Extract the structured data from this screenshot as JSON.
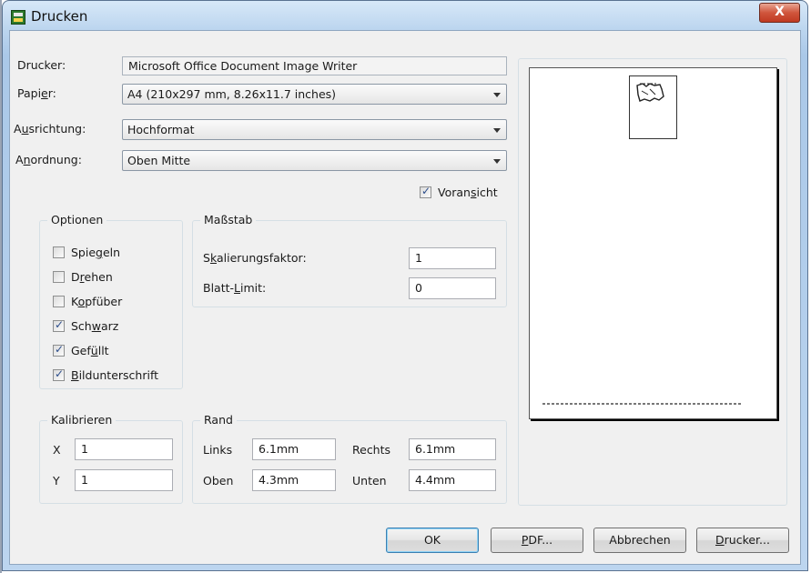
{
  "window": {
    "title": "Drucken",
    "close_glyph": "X"
  },
  "fields": {
    "drucker": {
      "label_pre": "Drucker:",
      "value": "Microsoft Office Document Image Writer"
    },
    "papier": {
      "label_pre": "Papi",
      "label_u": "e",
      "label_post": "r:",
      "value": "A4 (210x297 mm, 8.26x11.7 inches)"
    },
    "ausrichtung": {
      "label_pre": "A",
      "label_u": "u",
      "label_post": "srichtung:",
      "value": "Hochformat"
    },
    "anordnung": {
      "label_pre": "A",
      "label_u": "n",
      "label_post": "ordnung:",
      "value": "Oben Mitte"
    }
  },
  "preview_toggle": {
    "pre": "Voran",
    "u": "s",
    "post": "icht",
    "checked": true
  },
  "optionen": {
    "title": "Optionen",
    "items": [
      {
        "pre": "Spie",
        "u": "g",
        "post": "eln",
        "checked": false
      },
      {
        "pre": "D",
        "u": "r",
        "post": "ehen",
        "checked": false
      },
      {
        "pre": "K",
        "u": "o",
        "post": "pfüber",
        "checked": false
      },
      {
        "pre": "Sch",
        "u": "w",
        "post": "arz",
        "checked": true
      },
      {
        "pre": "Gef",
        "u": "ü",
        "post": "llt",
        "checked": true
      },
      {
        "pre": "",
        "u": "B",
        "post": "ildunterschrift",
        "checked": true
      }
    ]
  },
  "massstab": {
    "title": "Maßstab",
    "skalierung": {
      "pre": "S",
      "u": "k",
      "post": "alierungsfaktor:",
      "value": "1"
    },
    "blatt": {
      "pre": "Blatt-",
      "u": "L",
      "post": "imit:",
      "value": "0"
    }
  },
  "kalibrieren": {
    "title": "Kalibrieren",
    "x_label": "X",
    "x_value": "1",
    "y_label": "Y",
    "y_value": "1"
  },
  "rand": {
    "title": "Rand",
    "links_label": "Links",
    "links_value": "6.1mm",
    "rechts_label": "Rechts",
    "rechts_value": "6.1mm",
    "oben_label": "Oben",
    "oben_value": "4.3mm",
    "unten_label": "Unten",
    "unten_value": "4.4mm"
  },
  "buttons": {
    "ok": "OK",
    "pdf_u": "P",
    "pdf_post": "DF...",
    "abbrechen": "Abbrechen",
    "drucker_u": "D",
    "drucker_post": "rucker..."
  },
  "icons": {
    "app": "printer-app-icon",
    "close": "close-icon",
    "dropdown": "chevron-down-icon",
    "check": "checkmark-icon"
  }
}
